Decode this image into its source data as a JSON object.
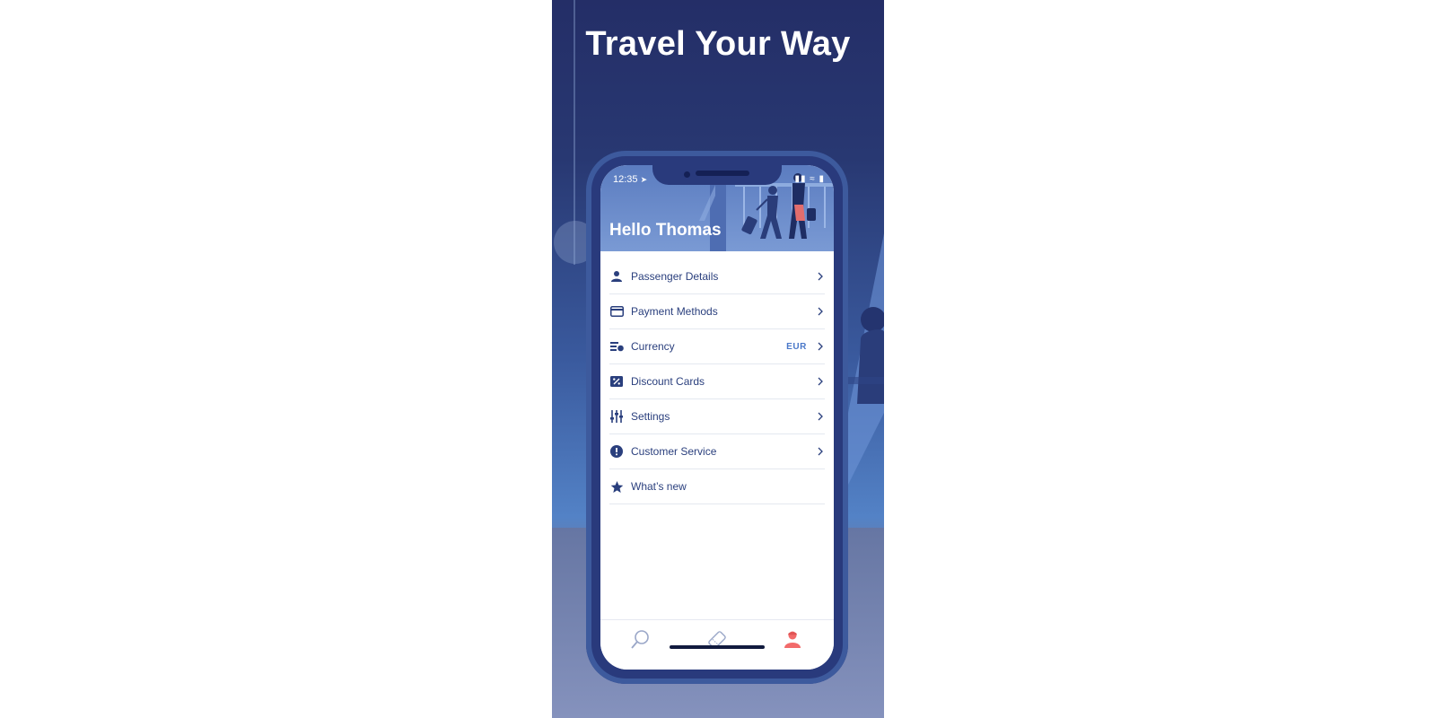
{
  "promo": {
    "headline": "Travel Your Way"
  },
  "status_bar": {
    "time": "12:35",
    "signal_icons": "▮▮ ≈ ▮"
  },
  "profile": {
    "greeting": "Hello Thomas"
  },
  "menu": [
    {
      "label": "Passenger Details",
      "icon": "person-icon",
      "value": "",
      "chevron": true
    },
    {
      "label": "Payment Methods",
      "icon": "credit-card-icon",
      "value": "",
      "chevron": true
    },
    {
      "label": "Currency",
      "icon": "currency-icon",
      "value": "EUR",
      "chevron": true
    },
    {
      "label": "Discount Cards",
      "icon": "discount-card-icon",
      "value": "",
      "chevron": true
    },
    {
      "label": "Settings",
      "icon": "sliders-icon",
      "value": "",
      "chevron": true
    },
    {
      "label": "Customer Service",
      "icon": "alert-circle-icon",
      "value": "",
      "chevron": true
    },
    {
      "label": "What’s new",
      "icon": "star-icon",
      "value": "",
      "chevron": false
    }
  ],
  "tabbar": {
    "tabs": [
      {
        "name": "search",
        "icon": "search-icon",
        "active": false
      },
      {
        "name": "tickets",
        "icon": "ticket-icon",
        "active": false
      },
      {
        "name": "profile",
        "icon": "profile-icon",
        "active": true
      }
    ]
  },
  "colors": {
    "primary": "#2a3f7d",
    "accent": "#4a78c9",
    "active_tab": "#f26b6b",
    "inactive_tab": "#9aa7c8"
  }
}
